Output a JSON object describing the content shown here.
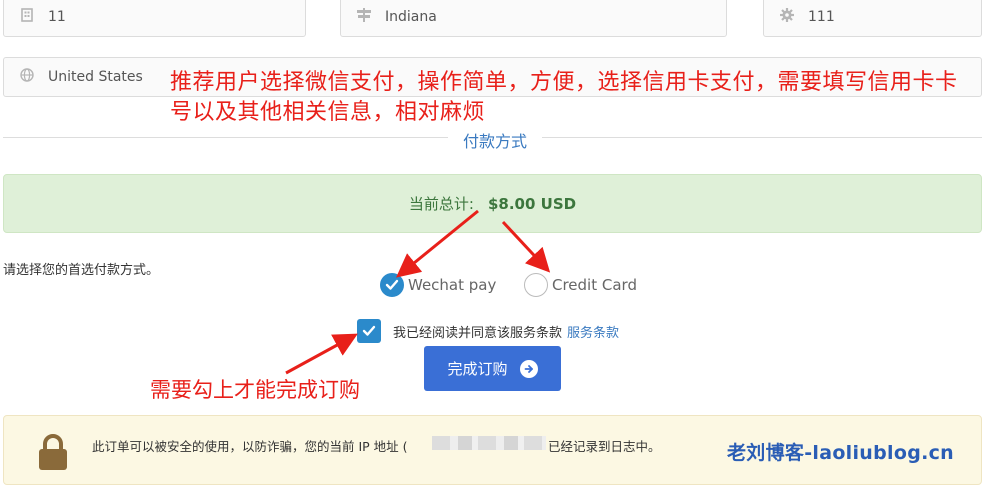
{
  "address": {
    "address2": {
      "value": "11",
      "icon": "building-icon"
    },
    "state": {
      "value": "Indiana",
      "icon": "signpost-icon"
    },
    "postcode": {
      "value": "111",
      "icon": "gear-icon"
    },
    "country": {
      "value": "United States",
      "icon": "globe-icon"
    }
  },
  "annotations": {
    "top": "推荐用户选择微信支付，操作简单，方便，选择信用卡支付，需要填写信用卡卡号以及其他相关信息，相对麻烦",
    "bottom": "需要勾上才能完成订购",
    "color": "#e8201a"
  },
  "payment": {
    "section_title": "付款方式",
    "total_label": "当前总计:",
    "total_amount": "$8.00 USD",
    "choose_label": "请选择您的首选付款方式。",
    "options": [
      {
        "label": "Wechat pay",
        "selected": true
      },
      {
        "label": "Credit Card",
        "selected": false
      }
    ]
  },
  "tos": {
    "checked": true,
    "text": "我已经阅读并同意该服务条款",
    "link": "服务条款"
  },
  "complete_button": {
    "label": "完成订购"
  },
  "notice": {
    "text_before": "此订单可以被安全的使用，以防诈骗，您的当前 IP 地址 (",
    "text_after": "已经记录到日志中。"
  },
  "watermark": "老刘博客-laoliublog.cn",
  "colors": {
    "accent": "#2b8acb",
    "button": "#3a6fd6",
    "success_bg": "#dff0d8",
    "warning_bg": "#fcf8e3"
  }
}
